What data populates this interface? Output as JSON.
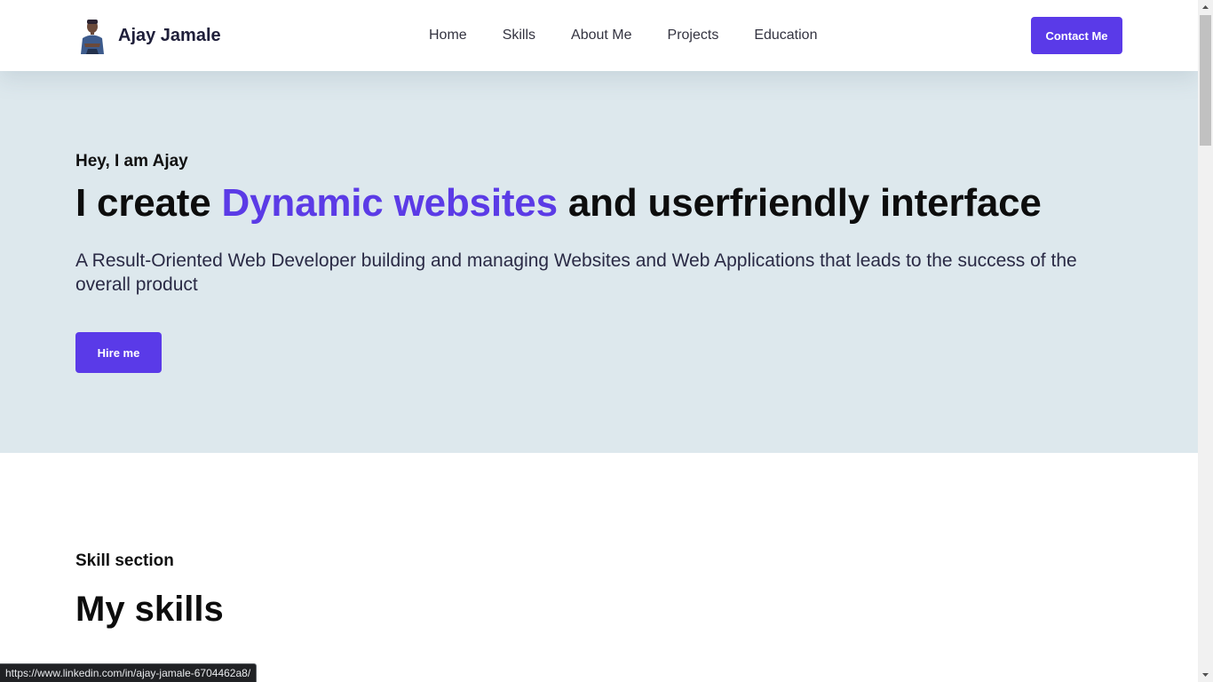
{
  "header": {
    "brand_name": "Ajay Jamale",
    "avatar_icon": "profile-photo",
    "nav": [
      "Home",
      "Skills",
      "About Me",
      "Projects",
      "Education"
    ],
    "contact_label": "Contact Me"
  },
  "hero": {
    "greeting": "Hey, I am Ajay",
    "title_prefix": "I create ",
    "title_accent": "Dynamic websites",
    "title_suffix": " and userfriendly interface",
    "description": "A Result-Oriented Web Developer building and managing Websites and Web Applications that leads to the success of the overall product",
    "hire_label": "Hire me"
  },
  "skills": {
    "subtitle": "Skill section",
    "title": "My skills"
  },
  "status_url": "https://www.linkedin.com/in/ajay-jamale-6704462a8/",
  "colors": {
    "accent": "#5a3ae8",
    "hero_bg": "#dde8ed",
    "heading": "#0d0d0d"
  }
}
